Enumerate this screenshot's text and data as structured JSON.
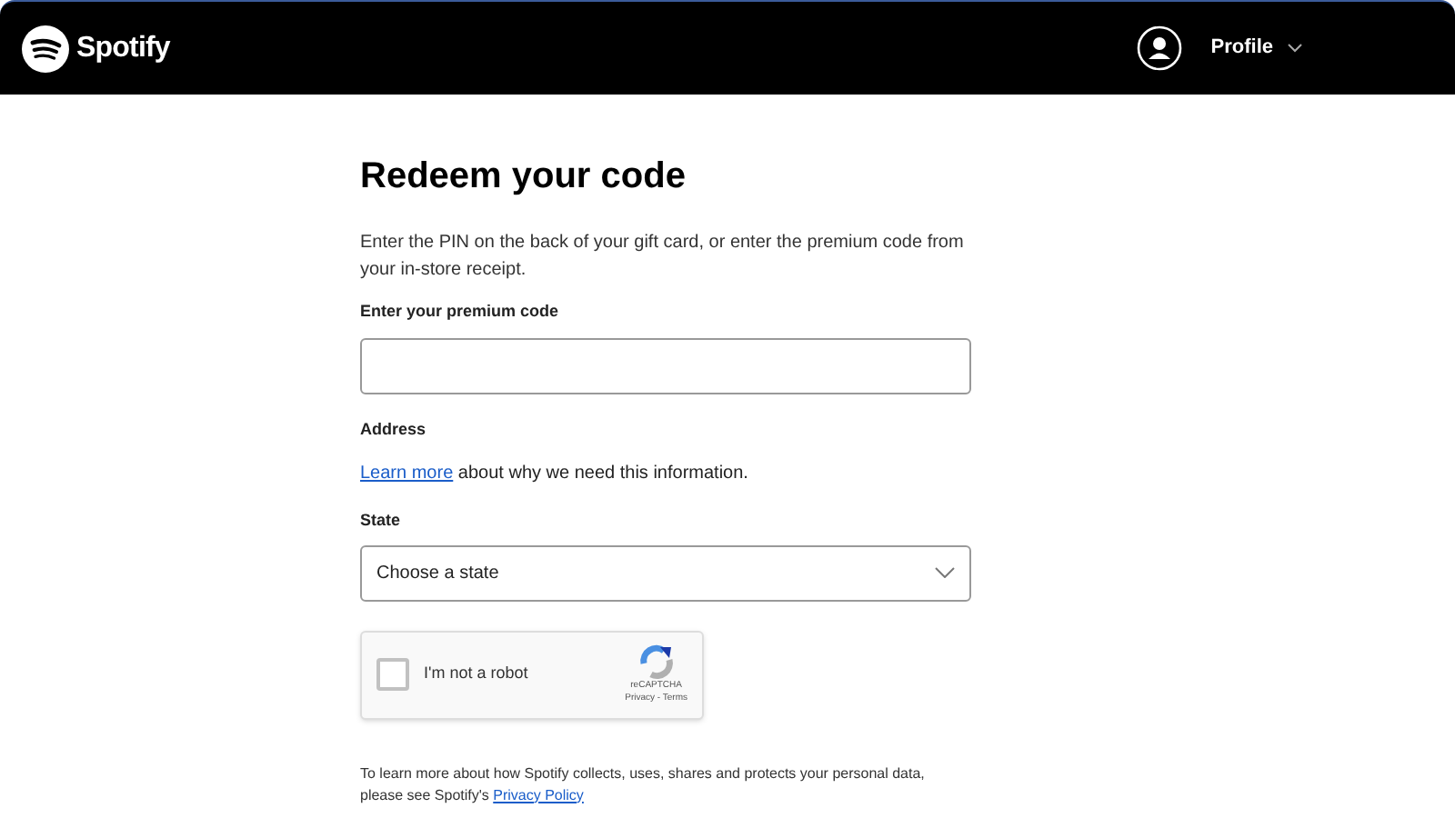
{
  "header": {
    "brand": "Spotify",
    "profile": {
      "label": "Profile"
    }
  },
  "form": {
    "title": "Redeem your code",
    "intro": "Enter the PIN on the back of your gift card, or enter the premium code from your in-store receipt.",
    "code_field": {
      "label": "Enter your premium code"
    },
    "address": {
      "heading": "Address",
      "link": "Learn more",
      "text": " about why we need this information."
    },
    "state_field": {
      "label": "State",
      "value": "Choose a state"
    },
    "captcha": {
      "label": "I'm not a robot",
      "checked": false,
      "brand": "reCAPTCHA",
      "links": "Privacy - Terms"
    },
    "privacy": {
      "text": "To learn more about how Spotify collects, uses, shares and protects your personal data, please see Spotify's ",
      "link": "Privacy Policy"
    }
  }
}
